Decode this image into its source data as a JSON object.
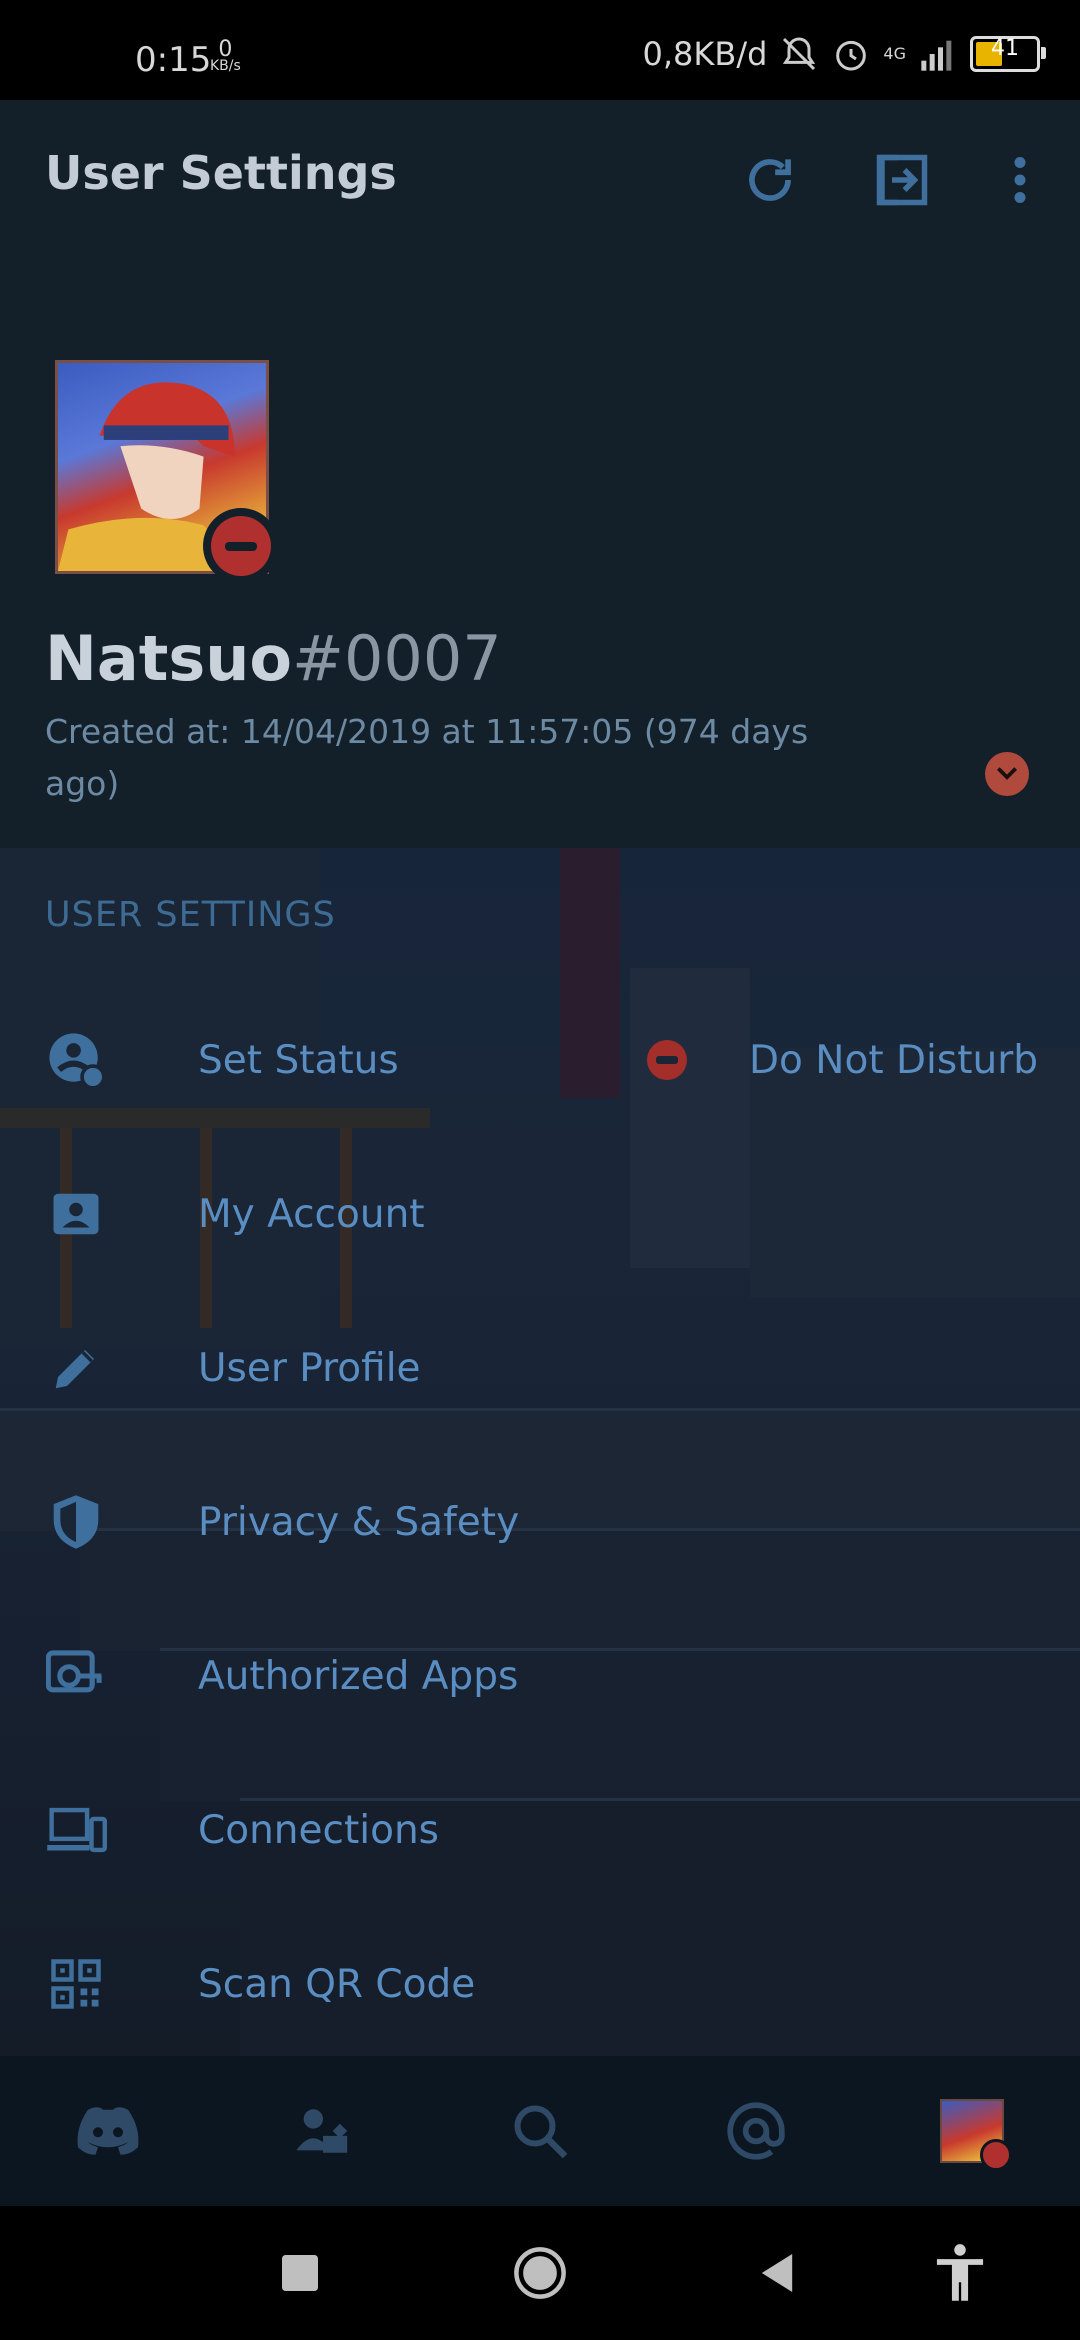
{
  "status_bar": {
    "time": "0:15",
    "speed_value": "0",
    "speed_unit": "KB/s",
    "data_usage": "0,8KB/d",
    "network": "4G",
    "battery": "41"
  },
  "app_bar": {
    "title": "User Settings",
    "icons": [
      "refresh-icon",
      "logout-icon",
      "more-vert-icon"
    ]
  },
  "profile": {
    "username": "Natsuo",
    "discriminator": "#0007",
    "created": "Created at: 14/04/2019 at 11:57:05 (974 days ago)",
    "status_color": "#b03030"
  },
  "section": {
    "title": "USER SETTINGS"
  },
  "settings_items": [
    {
      "label": "Set Status",
      "icon": "status-icon",
      "value": "Do Not Disturb"
    },
    {
      "label": "My Account",
      "icon": "account-card-icon"
    },
    {
      "label": "User Profile",
      "icon": "pencil-icon"
    },
    {
      "label": "Privacy & Safety",
      "icon": "shield-icon"
    },
    {
      "label": "Authorized Apps",
      "icon": "key-icon"
    },
    {
      "label": "Connections",
      "icon": "devices-icon"
    },
    {
      "label": "Scan QR Code",
      "icon": "qr-code-icon"
    }
  ],
  "bottom_nav": [
    "discord-home-icon",
    "friends-icon",
    "search-icon",
    "mentions-icon",
    "profile-avatar"
  ],
  "colors": {
    "accent": "#5a8ec2",
    "section_title": "#3e6b94",
    "dnd": "#b03030"
  }
}
